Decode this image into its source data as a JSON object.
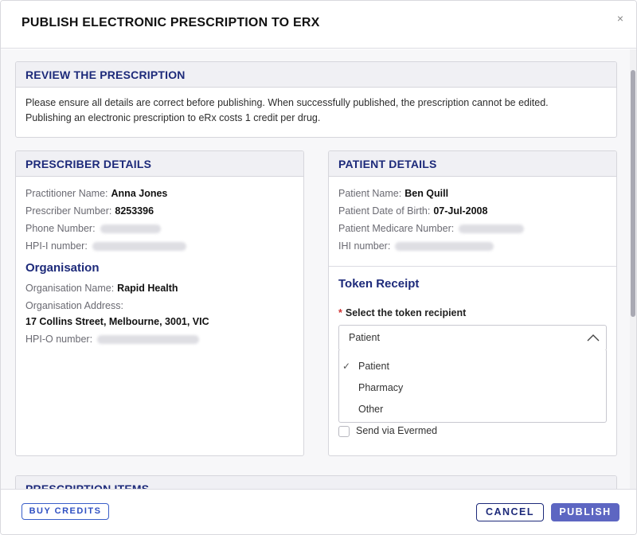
{
  "modal": {
    "title": "PUBLISH ELECTRONIC PRESCRIPTION TO ERX",
    "close_label": "×"
  },
  "review": {
    "heading": "REVIEW THE PRESCRIPTION",
    "line1": "Please ensure all details are correct before publishing. When successfully published, the prescription cannot be edited.",
    "line2": "Publishing an electronic prescription to eRx costs 1 credit per drug."
  },
  "prescriber": {
    "heading": "PRESCRIBER DETAILS",
    "practitioner_label": "Practitioner Name:",
    "practitioner_value": "Anna Jones",
    "prescriber_number_label": "Prescriber Number:",
    "prescriber_number_value": "8253396",
    "phone_label": "Phone Number:",
    "hpii_label": "HPI-I number:",
    "organisation_title": "Organisation",
    "org_name_label": "Organisation Name:",
    "org_name_value": "Rapid Health",
    "org_address_label": "Organisation Address:",
    "org_address_value": "17 Collins Street, Melbourne, 3001, VIC",
    "hpio_label": "HPI-O number:"
  },
  "patient": {
    "heading": "PATIENT DETAILS",
    "name_label": "Patient Name:",
    "name_value": "Ben Quill",
    "dob_label": "Patient Date of Birth:",
    "dob_value": "07-Jul-2008",
    "medicare_label": "Patient Medicare Number:",
    "ihi_label": "IHI number:"
  },
  "token": {
    "title": "Token Receipt",
    "required_mark": "*",
    "label": "Select the token recipient",
    "selected": "Patient",
    "options": [
      "Patient",
      "Pharmacy",
      "Other"
    ],
    "send_via_label": "Send via Evermed"
  },
  "items": {
    "heading": "PRESCRIPTION ITEMS"
  },
  "footer": {
    "buy_credits": "BUY CREDITS",
    "cancel": "CANCEL",
    "publish": "PUBLISH"
  },
  "colors": {
    "heading_navy": "#1d2a7a",
    "primary": "#5d66c2",
    "link_blue": "#2f50c2"
  }
}
